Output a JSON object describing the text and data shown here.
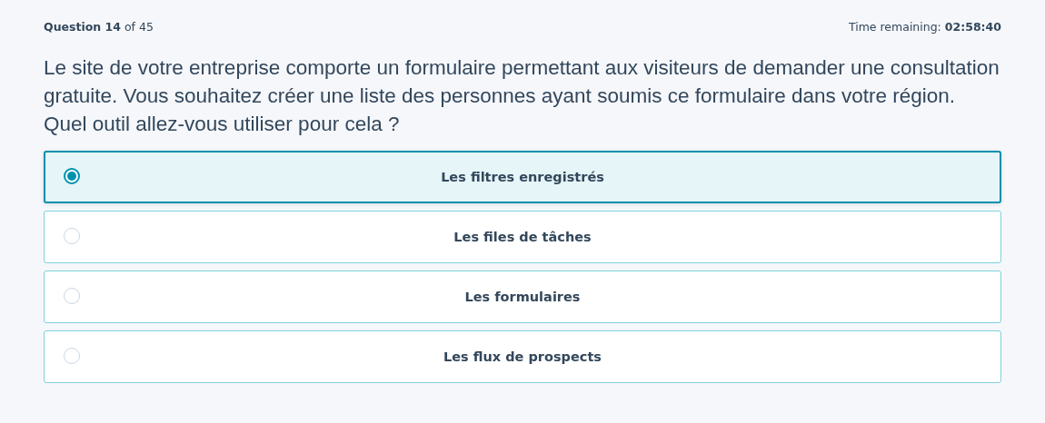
{
  "header": {
    "progress": "**Question 14** of 45",
    "timer": "Time remaining: **02:58:40**"
  },
  "question": "Le site de votre entreprise comporte un formulaire permettant aux visiteurs de demander une consultation gratuite. Vous souhaitez créer une liste des personnes ayant soumis ce formulaire dans votre région. Quel outil allez-vous utiliser pour cela ?",
  "options": [
    {
      "label": "Les filtres enregistrés",
      "selected": true
    },
    {
      "label": "Les files de tâches",
      "selected": false
    },
    {
      "label": "Les formulaires",
      "selected": false
    },
    {
      "label": "Les flux de prospects",
      "selected": false
    }
  ]
}
